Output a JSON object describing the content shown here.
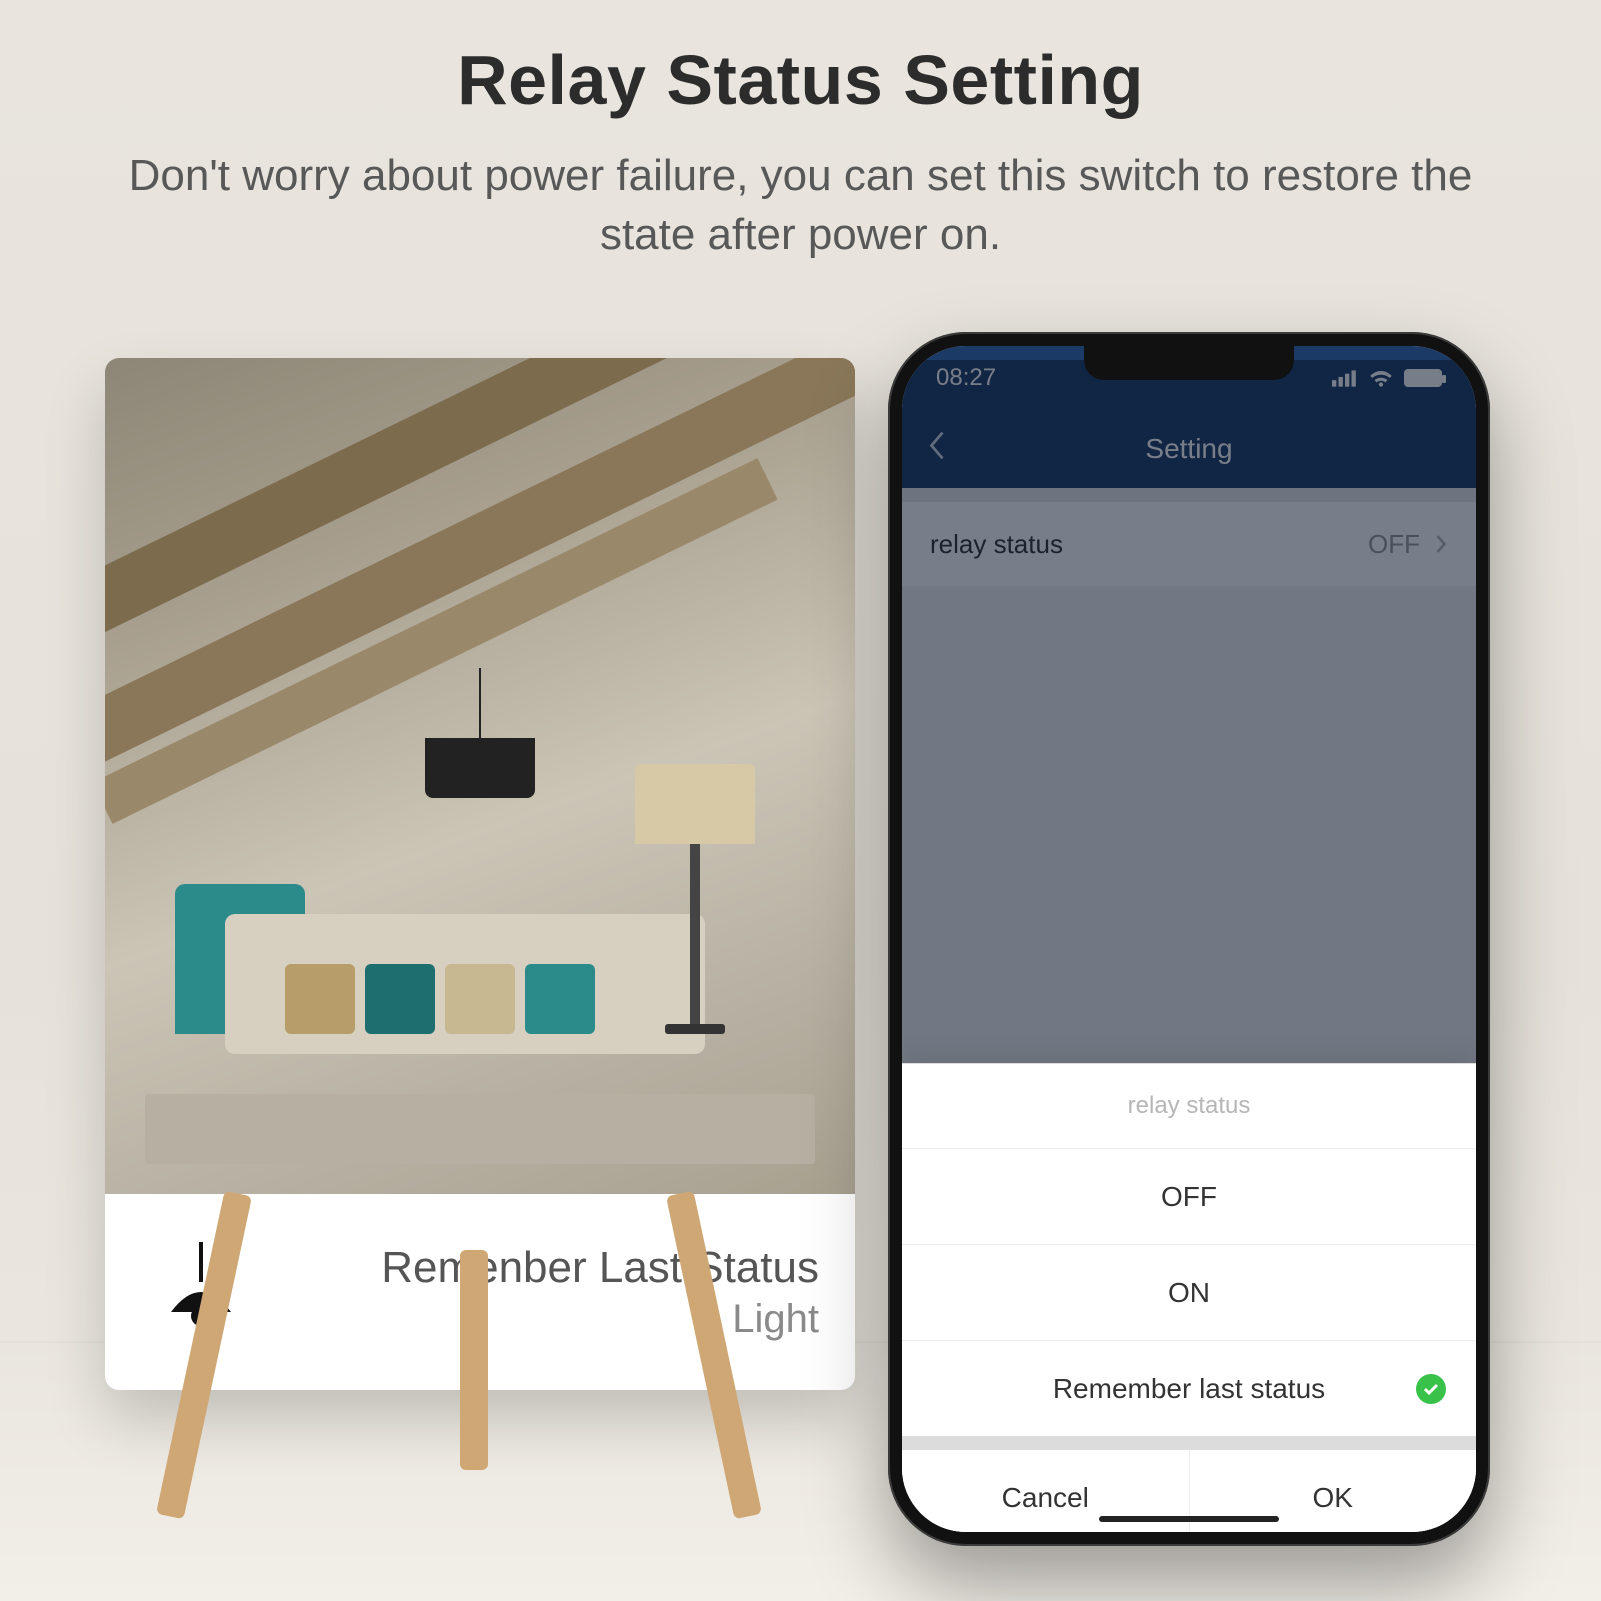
{
  "hero": {
    "title": "Relay Status Setting",
    "subtitle": "Don't worry about power failure, you can set this switch to restore the state after power on."
  },
  "card": {
    "title": "Remenber Last Status",
    "subtitle": "Light"
  },
  "phone": {
    "statusbar": {
      "time": "08:27"
    },
    "header": {
      "title": "Setting"
    },
    "row": {
      "label": "relay status",
      "value": "OFF"
    },
    "sheet": {
      "title": "relay status",
      "options": [
        {
          "label": "OFF",
          "selected": false
        },
        {
          "label": "ON",
          "selected": false
        },
        {
          "label": "Remember last status",
          "selected": true
        }
      ],
      "cancel": "Cancel",
      "ok": "OK"
    }
  }
}
